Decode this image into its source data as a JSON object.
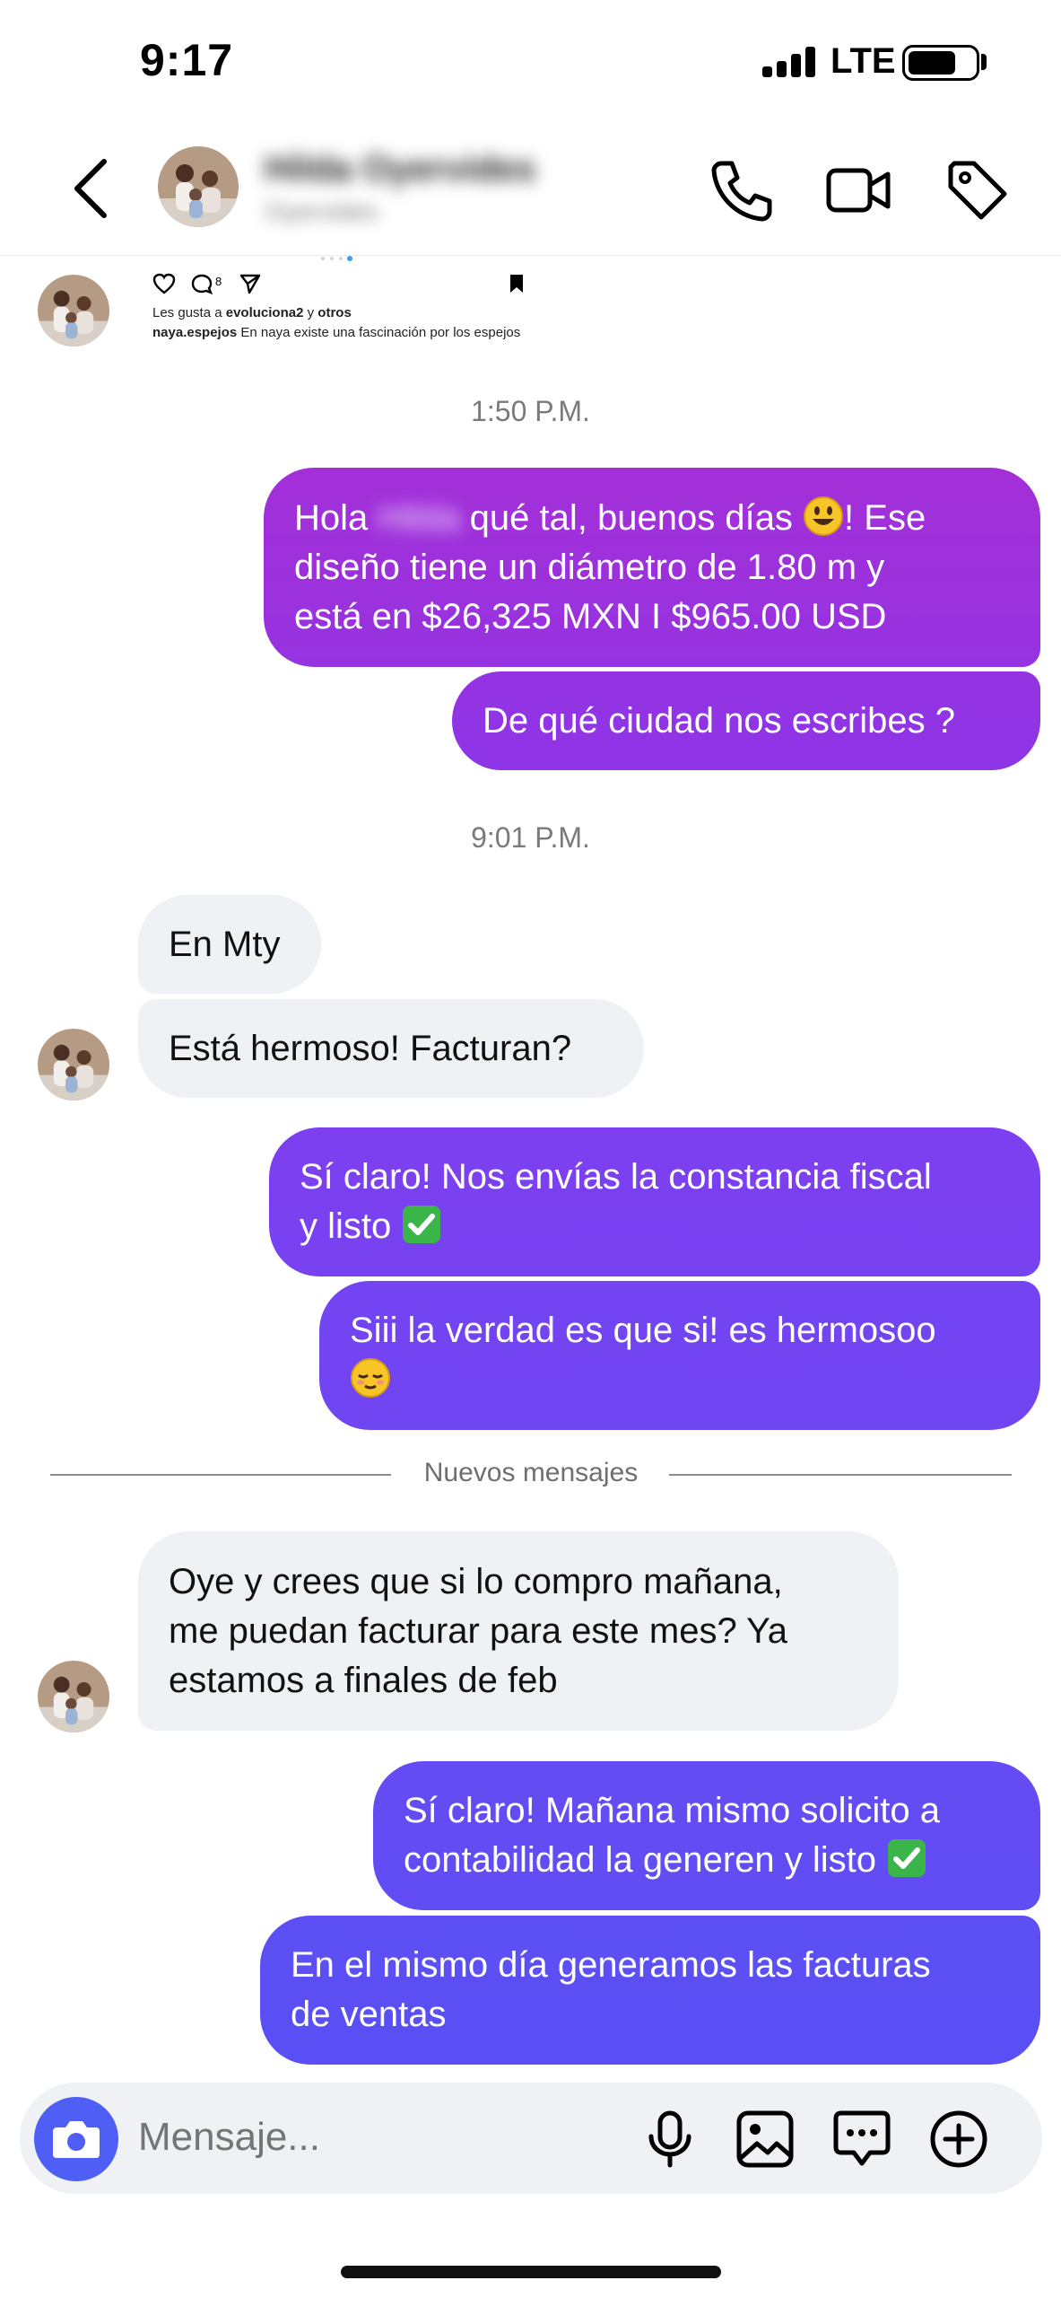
{
  "status_bar": {
    "time": "9:17",
    "network": "LTE",
    "icons": [
      "signal-icon",
      "battery-icon"
    ]
  },
  "header": {
    "contact_name": "Hilda Oyervides",
    "contact_subtitle": "Oyervides",
    "icons": [
      "back-icon",
      "phone-icon",
      "video-icon",
      "tag-icon"
    ]
  },
  "post_preview": {
    "comment_count": "8",
    "likes_prefix": "Les gusta a ",
    "likes_user": "evoluciona2",
    "likes_middle": " y ",
    "likes_others": "otros",
    "caption_user": "naya.espejos",
    "caption_text": " En naya existe una fascinación por los espejos"
  },
  "timestamps": [
    "1:50 P.M.",
    "9:01 P.M."
  ],
  "messages": [
    {
      "from": "me",
      "before": "Hola ",
      "hidden": "Hilda",
      "after": " qué tal, buenos días ",
      "emoji": "smiley",
      "line1_end": "! Ese",
      "line2": "diseño tiene un diámetro de 1.80 m y",
      "line3": "está en $26,325 MXN I $965.00 USD"
    },
    {
      "from": "me",
      "text": "De qué ciudad nos escribes ?"
    },
    {
      "from": "them",
      "text": "En Mty"
    },
    {
      "from": "them",
      "text": "Está hermoso! Facturan?"
    },
    {
      "from": "me",
      "line1": "Sí claro! Nos envías la constancia fiscal",
      "line2": "y listo ",
      "emoji": "check"
    },
    {
      "from": "me",
      "line1": "Siii la verdad es que si! es hermosoo",
      "emoji": "relieved"
    },
    {
      "from": "them",
      "line1": "Oye y crees que si lo compro mañana,",
      "line2": "me puedan facturar para este mes? Ya",
      "line3": "estamos a finales de feb"
    },
    {
      "from": "me",
      "line1": "Sí claro! Mañana mismo solicito a",
      "line2": "contabilidad la generen y listo ",
      "emoji": "check"
    },
    {
      "from": "me",
      "line1": "En el mismo día generamos las facturas",
      "line2": "de ventas"
    }
  ],
  "divider": {
    "label": "Nuevos mensajes"
  },
  "composer": {
    "placeholder": "Mensaje...",
    "icons": [
      "camera-icon",
      "microphone-icon",
      "gallery-icon",
      "sticker-icon",
      "plus-icon"
    ]
  },
  "colors": {
    "bubble_gradient": [
      "#a12fd9",
      "#8e35ea",
      "#7b3ff1",
      "#6a48f3",
      "#5e4ff4"
    ],
    "incoming_bubble": "#f0f1f4",
    "accent": "#4f5ef5"
  }
}
